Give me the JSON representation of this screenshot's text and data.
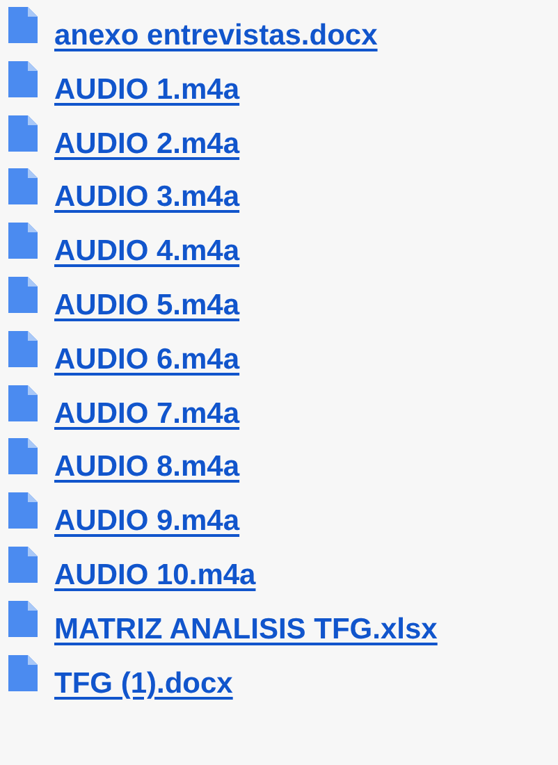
{
  "files": [
    {
      "name": "anexo entrevistas.docx"
    },
    {
      "name": "AUDIO 1.m4a"
    },
    {
      "name": "AUDIO 2.m4a"
    },
    {
      "name": "AUDIO 3.m4a"
    },
    {
      "name": "AUDIO 4.m4a"
    },
    {
      "name": "AUDIO 5.m4a"
    },
    {
      "name": "AUDIO 6.m4a"
    },
    {
      "name": "AUDIO 7.m4a"
    },
    {
      "name": "AUDIO 8.m4a"
    },
    {
      "name": "AUDIO 9.m4a"
    },
    {
      "name": "AUDIO 10.m4a"
    },
    {
      "name": "MATRIZ ANALISIS TFG.xlsx"
    },
    {
      "name": "TFG (1).docx"
    }
  ]
}
